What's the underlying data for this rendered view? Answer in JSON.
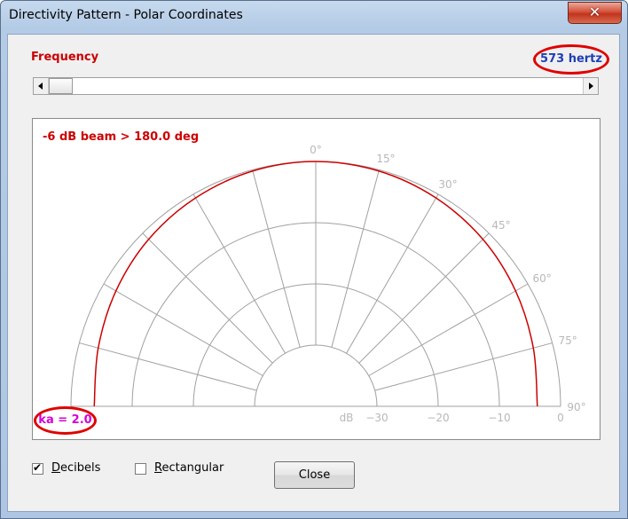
{
  "window": {
    "title": "Directivity Pattern - Polar Coordinates",
    "close_glyph": "✕"
  },
  "frequency": {
    "label": "Frequency",
    "value": "573 hertz",
    "slider_fraction": 0.0
  },
  "plot": {
    "beam_text": "-6 dB beam > 180.0 deg",
    "ka_text": "ka = 2.0",
    "angle_labels": [
      "0°",
      "15°",
      "30°",
      "45°",
      "60°",
      "75°",
      "90°"
    ],
    "db_labels": [
      "dB",
      "−30",
      "−20",
      "−10",
      "0"
    ],
    "curve_color": "#cc0000",
    "grid_color": "#a0a0a0"
  },
  "chart_data": {
    "type": "line",
    "title": "",
    "angle_ticks_deg": [
      0,
      15,
      30,
      45,
      60,
      75,
      90
    ],
    "radial_ticks_db": [
      -30,
      -20,
      -10,
      0
    ],
    "radial_range_db": [
      -40,
      0
    ],
    "series": [
      {
        "angle_deg": [
          0,
          15,
          30,
          45,
          60,
          75,
          90
        ],
        "level_db": [
          0,
          -0.2,
          -0.7,
          -1.4,
          -2.3,
          -3.2,
          -3.8
        ]
      }
    ]
  },
  "controls": {
    "decibels": {
      "label_u": "D",
      "label_rest": "ecibels",
      "checked": true
    },
    "rectangular": {
      "label_u": "R",
      "label_rest": "ectangular",
      "checked": false
    },
    "close_label": "Close"
  }
}
